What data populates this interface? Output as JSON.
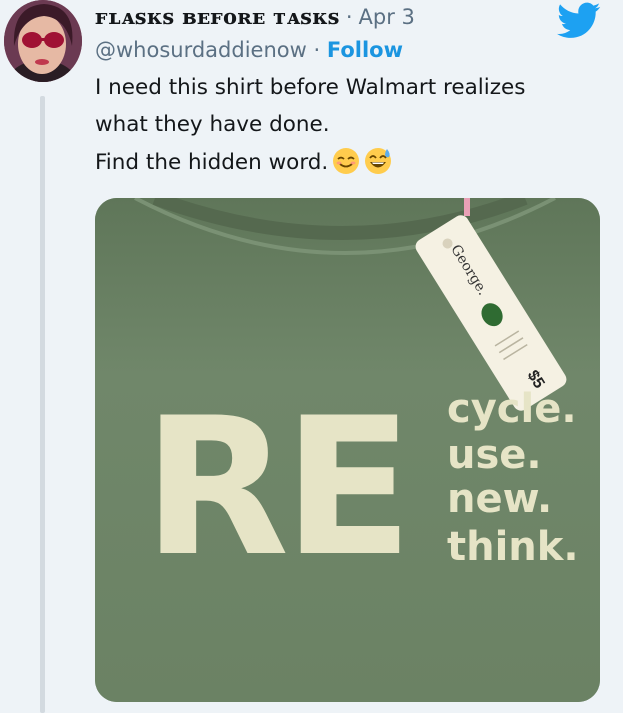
{
  "tweet": {
    "display_name": "ꜰʟᴀꜱᴋꜱ ʙᴇꜰᴏʀᴇ ᴛᴀꜱᴋꜱ",
    "separator": "·",
    "date": "Apr 3",
    "handle": "@whosurdaddienow",
    "follow_separator": " · ",
    "follow_label": "Follow",
    "text_lines": [
      "I need this shirt before Walmart realizes",
      "what they have done.",
      "Find the hidden word."
    ],
    "emojis": [
      "relieved-face",
      "grinning-sweat-face"
    ]
  },
  "image": {
    "tag_brand": "George.",
    "tag_price": "$5",
    "shirt_big_letters": "RE",
    "shirt_words": [
      "cycle.",
      "use.",
      "new.",
      "think."
    ]
  },
  "colors": {
    "twitter_blue": "#1da1f2",
    "follow_blue": "#1b95e0",
    "secondary_text": "#5b7083",
    "background": "#eef3f7",
    "shirt_green": "#6d8467",
    "print_cream": "#e6e4c6"
  }
}
